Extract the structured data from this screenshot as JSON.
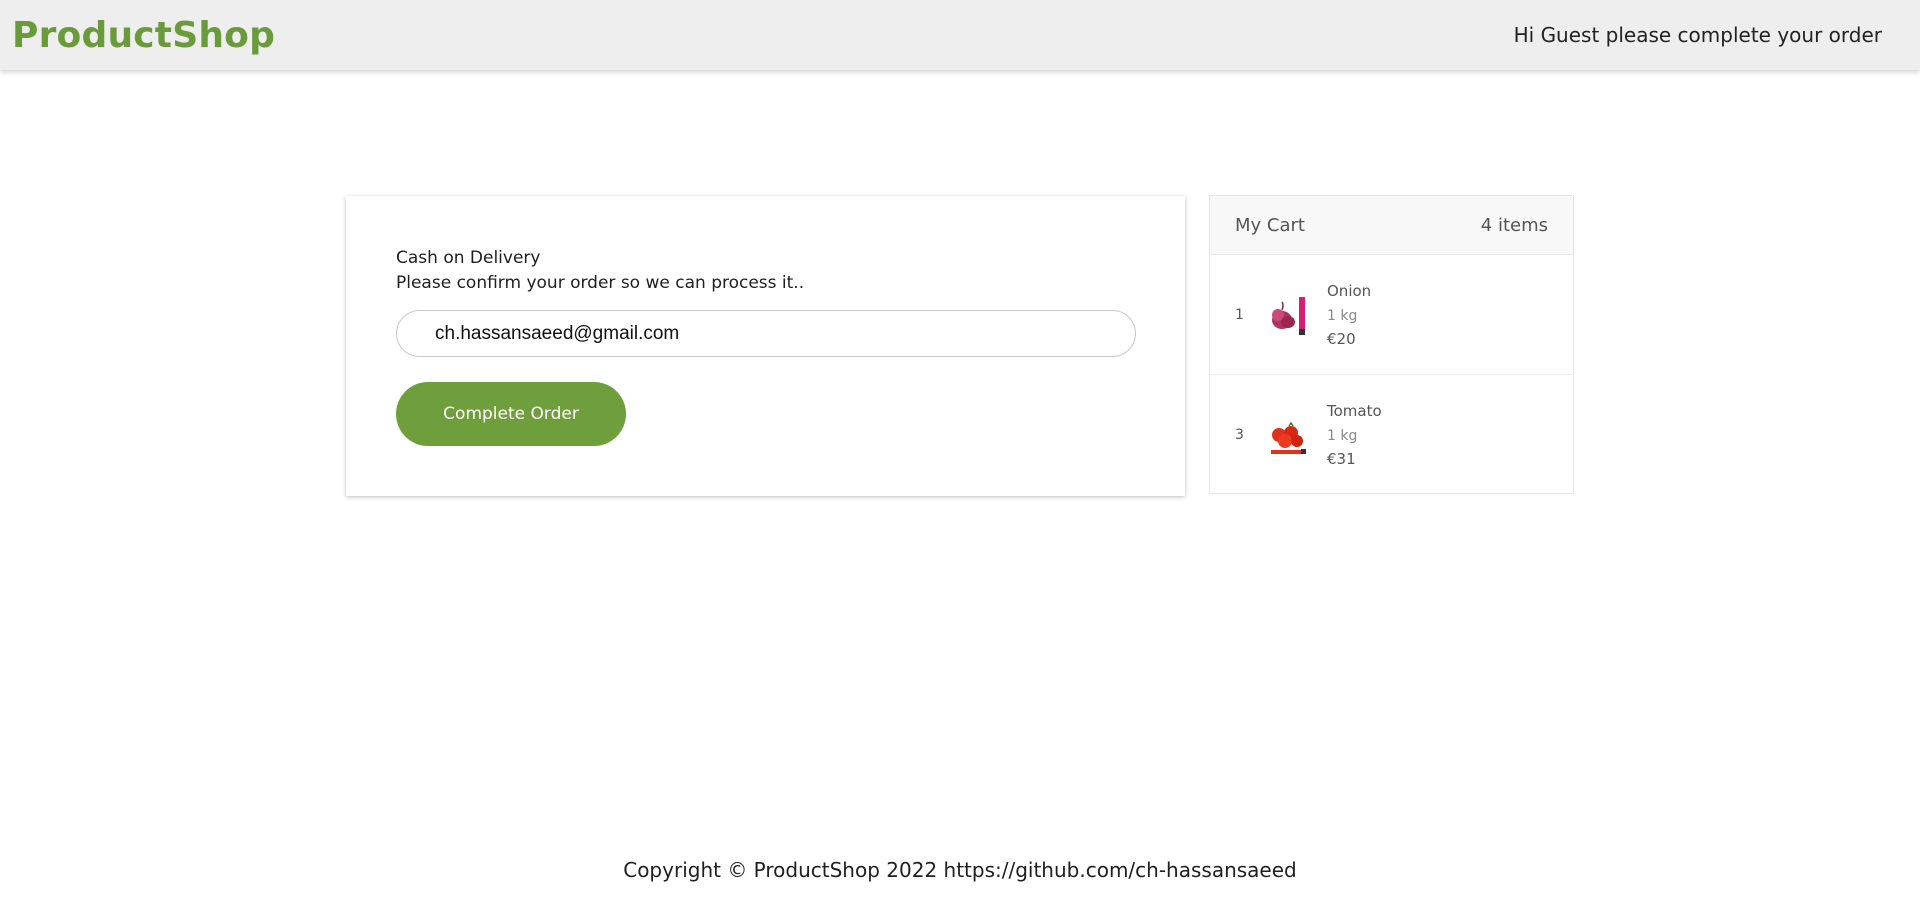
{
  "header": {
    "brand": "ProductShop",
    "greeting": "Hi Guest please complete your order",
    "brand_color": "#6a9b3a"
  },
  "order": {
    "payment_title": "Cash on Delivery",
    "payment_subtitle": "Please confirm your order so we can process it..",
    "email_value": "ch.hassansaeed@gmail.com",
    "complete_button_label": "Complete Order",
    "button_color": "#6f9f3d"
  },
  "cart": {
    "title": "My Cart",
    "count_label": "4 items",
    "items": [
      {
        "qty": "1",
        "name": "Onion",
        "unit": "1 kg",
        "price": "€20",
        "thumb_icon": "onion-product-icon"
      },
      {
        "qty": "3",
        "name": "Tomato",
        "unit": "1 kg",
        "price": "€31",
        "thumb_icon": "tomato-product-icon"
      }
    ]
  },
  "footer": {
    "copyright": "Copyright © ProductShop 2022 https://github.com/ch-hassansaeed"
  }
}
